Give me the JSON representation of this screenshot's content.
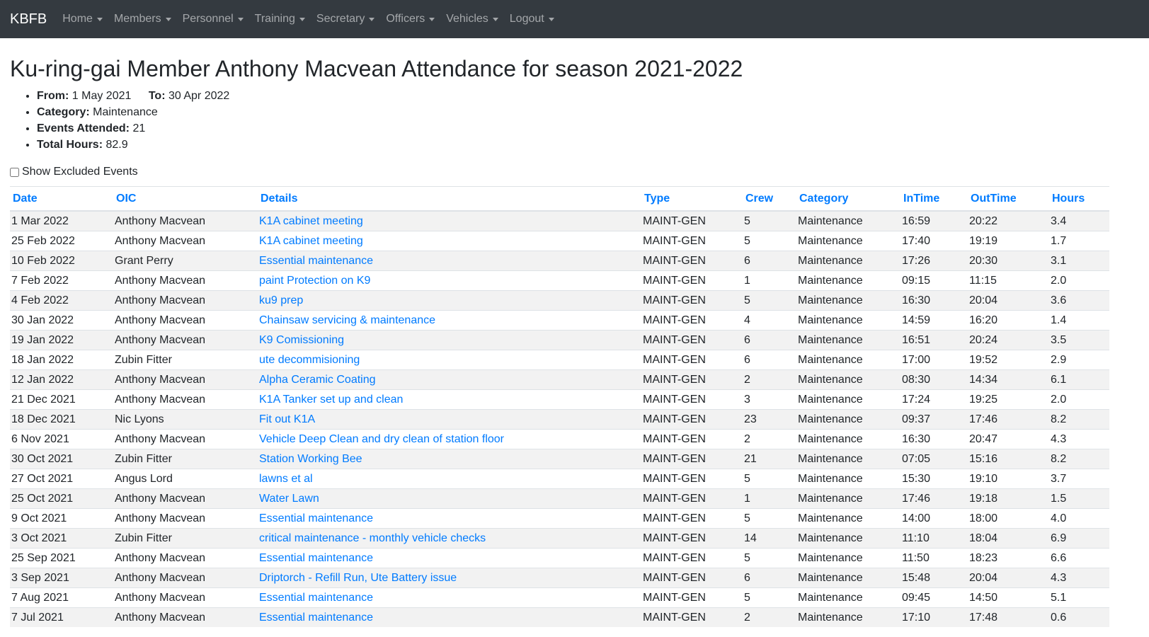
{
  "navbar": {
    "brand": "KBFB",
    "items": [
      {
        "label": "Home",
        "name": "nav-home"
      },
      {
        "label": "Members",
        "name": "nav-members"
      },
      {
        "label": "Personnel",
        "name": "nav-personnel"
      },
      {
        "label": "Training",
        "name": "nav-training"
      },
      {
        "label": "Secretary",
        "name": "nav-secretary"
      },
      {
        "label": "Officers",
        "name": "nav-officers"
      },
      {
        "label": "Vehicles",
        "name": "nav-vehicles"
      },
      {
        "label": "Logout",
        "name": "nav-logout"
      }
    ]
  },
  "page": {
    "title": "Ku-ring-gai Member Anthony Macvean Attendance for season 2021-2022",
    "from_label": "From:",
    "from_value": "1 May 2021",
    "to_label": "To:",
    "to_value": "30 Apr 2022",
    "category_label": "Category:",
    "category_value": "Maintenance",
    "events_label": "Events Attended:",
    "events_value": "21",
    "hours_label": "Total Hours:",
    "hours_value": "82.9",
    "show_excluded_label": "Show Excluded Events"
  },
  "table": {
    "headers": [
      "Date",
      "OIC",
      "Details",
      "Type",
      "Crew",
      "Category",
      "InTime",
      "OutTime",
      "Hours"
    ],
    "rows": [
      [
        "1 Mar 2022",
        "Anthony Macvean",
        "K1A cabinet meeting",
        "MAINT-GEN",
        "5",
        "Maintenance",
        "16:59",
        "20:22",
        "3.4"
      ],
      [
        "25 Feb 2022",
        "Anthony Macvean",
        "K1A cabinet meeting",
        "MAINT-GEN",
        "5",
        "Maintenance",
        "17:40",
        "19:19",
        "1.7"
      ],
      [
        "10 Feb 2022",
        "Grant Perry",
        "Essential maintenance",
        "MAINT-GEN",
        "6",
        "Maintenance",
        "17:26",
        "20:30",
        "3.1"
      ],
      [
        "7 Feb 2022",
        "Anthony Macvean",
        "paint Protection on K9",
        "MAINT-GEN",
        "1",
        "Maintenance",
        "09:15",
        "11:15",
        "2.0"
      ],
      [
        "4 Feb 2022",
        "Anthony Macvean",
        "ku9 prep",
        "MAINT-GEN",
        "5",
        "Maintenance",
        "16:30",
        "20:04",
        "3.6"
      ],
      [
        "30 Jan 2022",
        "Anthony Macvean",
        "Chainsaw servicing & maintenance",
        "MAINT-GEN",
        "4",
        "Maintenance",
        "14:59",
        "16:20",
        "1.4"
      ],
      [
        "19 Jan 2022",
        "Anthony Macvean",
        "K9 Comissioning",
        "MAINT-GEN",
        "6",
        "Maintenance",
        "16:51",
        "20:24",
        "3.5"
      ],
      [
        "18 Jan 2022",
        "Zubin Fitter",
        "ute decommisioning",
        "MAINT-GEN",
        "6",
        "Maintenance",
        "17:00",
        "19:52",
        "2.9"
      ],
      [
        "12 Jan 2022",
        "Anthony Macvean",
        "Alpha Ceramic Coating",
        "MAINT-GEN",
        "2",
        "Maintenance",
        "08:30",
        "14:34",
        "6.1"
      ],
      [
        "21 Dec 2021",
        "Anthony Macvean",
        "K1A Tanker set up and clean",
        "MAINT-GEN",
        "3",
        "Maintenance",
        "17:24",
        "19:25",
        "2.0"
      ],
      [
        "18 Dec 2021",
        "Nic Lyons",
        "Fit out K1A",
        "MAINT-GEN",
        "23",
        "Maintenance",
        "09:37",
        "17:46",
        "8.2"
      ],
      [
        "6 Nov 2021",
        "Anthony Macvean",
        "Vehicle Deep Clean and dry clean of station floor",
        "MAINT-GEN",
        "2",
        "Maintenance",
        "16:30",
        "20:47",
        "4.3"
      ],
      [
        "30 Oct 2021",
        "Zubin Fitter",
        "Station Working Bee",
        "MAINT-GEN",
        "21",
        "Maintenance",
        "07:05",
        "15:16",
        "8.2"
      ],
      [
        "27 Oct 2021",
        "Angus Lord",
        "lawns et al",
        "MAINT-GEN",
        "5",
        "Maintenance",
        "15:30",
        "19:10",
        "3.7"
      ],
      [
        "25 Oct 2021",
        "Anthony Macvean",
        "Water Lawn",
        "MAINT-GEN",
        "1",
        "Maintenance",
        "17:46",
        "19:18",
        "1.5"
      ],
      [
        "9 Oct 2021",
        "Anthony Macvean",
        "Essential maintenance",
        "MAINT-GEN",
        "5",
        "Maintenance",
        "14:00",
        "18:00",
        "4.0"
      ],
      [
        "3 Oct 2021",
        "Zubin Fitter",
        "critical maintenance - monthly vehicle checks",
        "MAINT-GEN",
        "14",
        "Maintenance",
        "11:10",
        "18:04",
        "6.9"
      ],
      [
        "25 Sep 2021",
        "Anthony Macvean",
        "Essential maintenance",
        "MAINT-GEN",
        "5",
        "Maintenance",
        "11:50",
        "18:23",
        "6.6"
      ],
      [
        "3 Sep 2021",
        "Anthony Macvean",
        "Driptorch - Refill Run, Ute Battery issue",
        "MAINT-GEN",
        "6",
        "Maintenance",
        "15:48",
        "20:04",
        "4.3"
      ],
      [
        "7 Aug 2021",
        "Anthony Macvean",
        "Essential maintenance",
        "MAINT-GEN",
        "5",
        "Maintenance",
        "09:45",
        "14:50",
        "5.1"
      ],
      [
        "7 Jul 2021",
        "Anthony Macvean",
        "Essential maintenance",
        "MAINT-GEN",
        "2",
        "Maintenance",
        "17:10",
        "17:48",
        "0.6"
      ]
    ]
  }
}
